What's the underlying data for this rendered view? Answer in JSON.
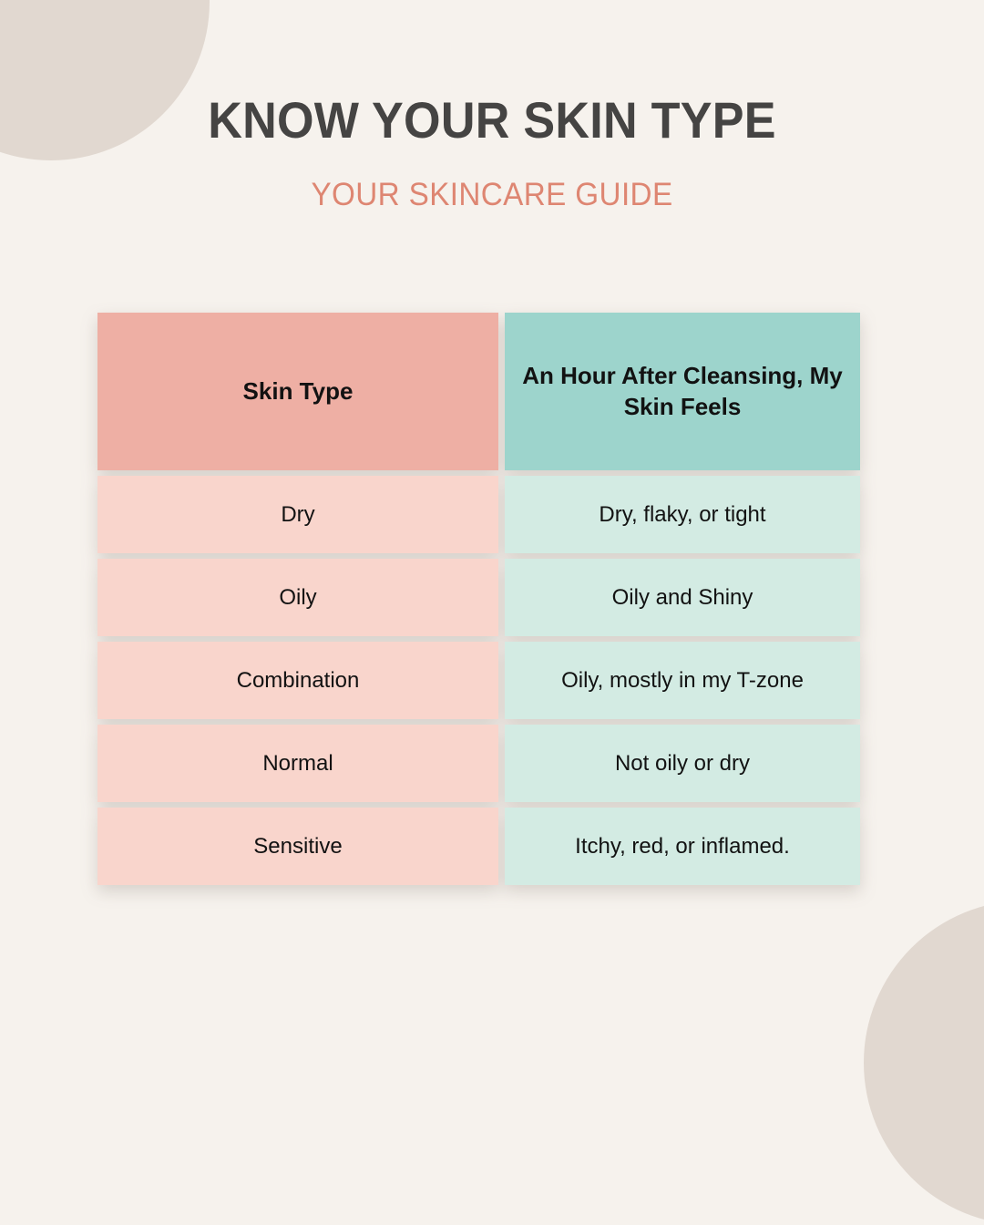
{
  "theme": {
    "background": "#f6f2ed",
    "deco_circle": "#e1d8d0",
    "title_color": "#454443",
    "subtitle_color": "#de8672",
    "header_type_bg": "#eeafa4",
    "header_feel_bg": "#9dd4cc",
    "row_type_bg": "#f9d5cc",
    "row_feel_bg": "#d3ebe3",
    "cell_text": "#121212"
  },
  "header": {
    "title": "KNOW YOUR SKIN TYPE",
    "subtitle": "YOUR SKINCARE GUIDE"
  },
  "table": {
    "columns": [
      {
        "key": "skin_type",
        "label": "Skin Type"
      },
      {
        "key": "feel",
        "label": "An Hour After Cleansing, My Skin Feels"
      }
    ],
    "rows": [
      {
        "skin_type": "Dry",
        "feel": "Dry, flaky, or tight"
      },
      {
        "skin_type": "Oily",
        "feel": "Oily and Shiny"
      },
      {
        "skin_type": "Combination",
        "feel": "Oily, mostly in my T-zone"
      },
      {
        "skin_type": "Normal",
        "feel": "Not oily or dry"
      },
      {
        "skin_type": "Sensitive",
        "feel": "Itchy, red, or inflamed."
      }
    ]
  }
}
